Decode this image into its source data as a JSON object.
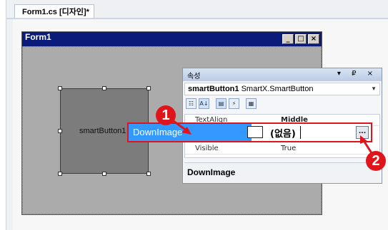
{
  "designer": {
    "tab_label": "Form1.cs [디자인]*"
  },
  "form": {
    "title": "Form1",
    "caption_buttons": {
      "minimize": "_",
      "maximize": "□",
      "close": "×"
    },
    "smart_button_label": "smartButton1"
  },
  "properties": {
    "panel_title": "속성",
    "panel_controls": "▾ ₽ ×",
    "object_name": "smartButton1",
    "object_type": "SmartX.SmartButton",
    "rows": [
      {
        "name": "TextAlign",
        "value": "Middle"
      },
      {
        "name": "Visible",
        "value": "True"
      }
    ],
    "selected_row": {
      "name": "DownImage",
      "value": "(없음)",
      "ellipsis": "..."
    },
    "description_title": "DownImage"
  },
  "callouts": {
    "step1": "1",
    "step2": "2"
  },
  "colors": {
    "highlight": "#e0151b",
    "selection": "#3399ff",
    "form_titlebar": "#0a1b7a"
  }
}
